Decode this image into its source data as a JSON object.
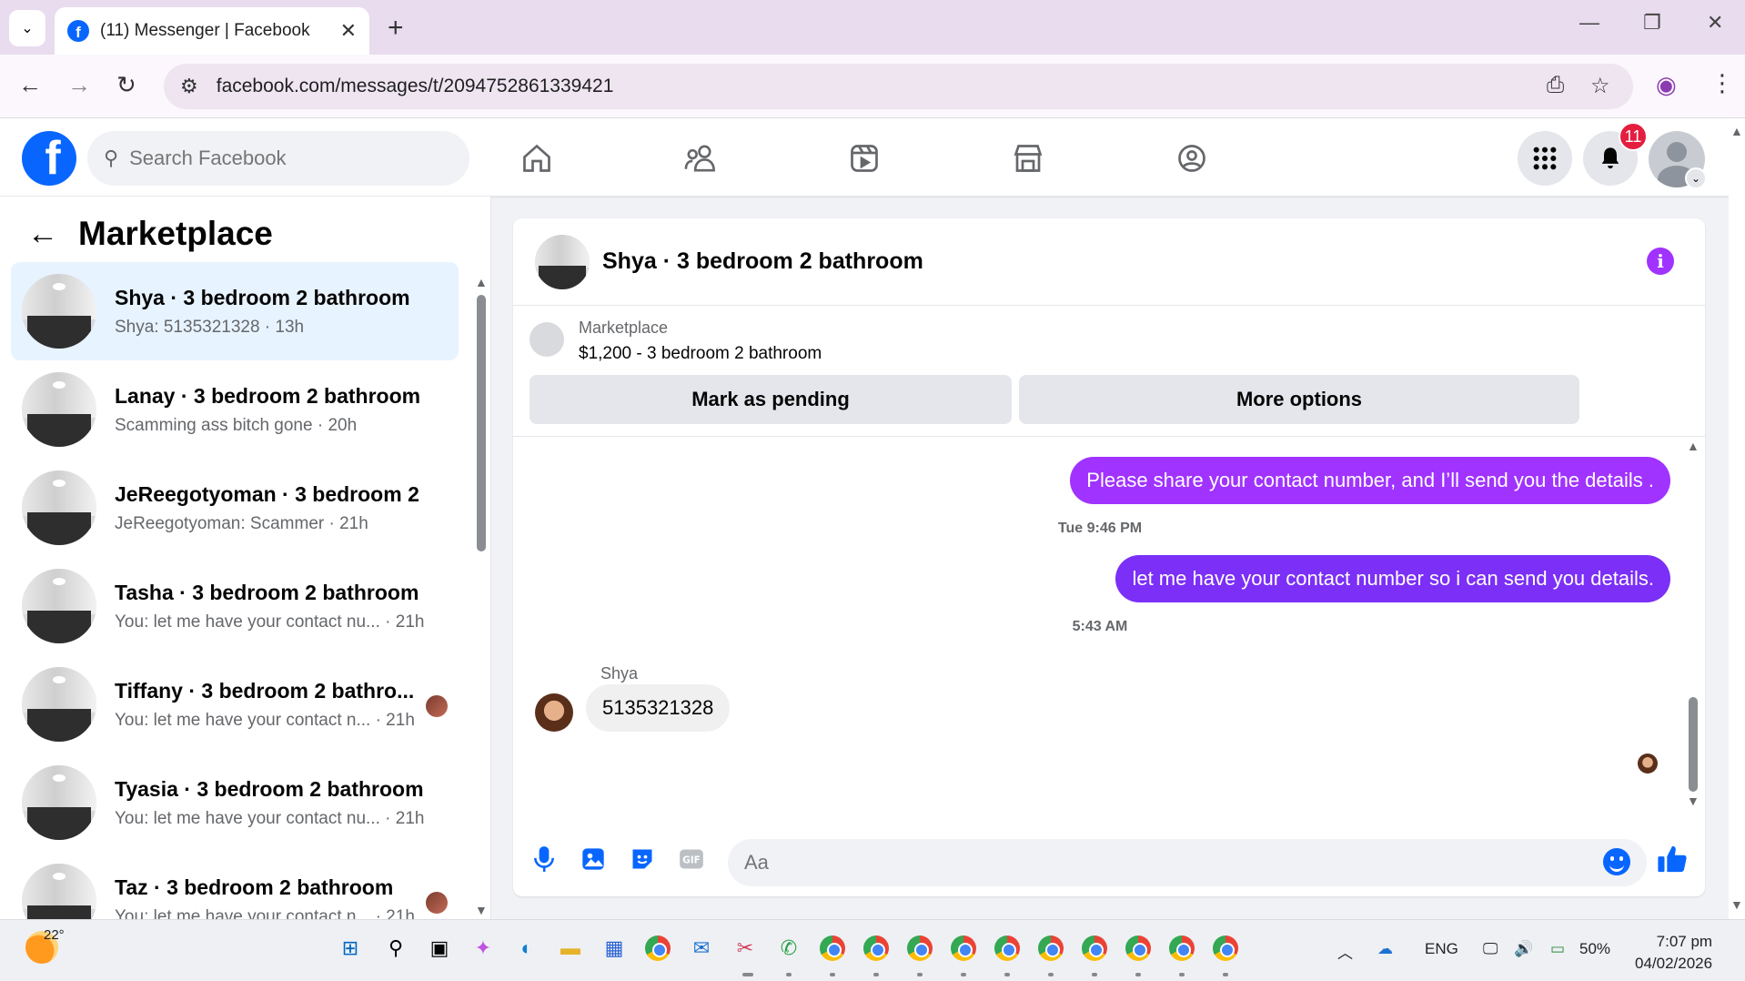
{
  "browser": {
    "tab_title": "(11) Messenger | Facebook",
    "url": "facebook.com/messages/t/2094752861339421"
  },
  "fb": {
    "search_placeholder": "Search Facebook",
    "notification_count": "11",
    "brand_color": "#0866ff"
  },
  "left": {
    "heading": "Marketplace",
    "conversations": [
      {
        "name": "Shya · 3 bedroom 2 bathroom",
        "preview": "Shya: 5135321328 · 13h",
        "active": true
      },
      {
        "name": "Lanay · 3 bedroom 2 bathroom",
        "preview": "Scamming ass bitch gone · 20h"
      },
      {
        "name": "JeReegotyoman · 3 bedroom 2 ...",
        "preview": "JeReegotyoman: Scammer · 21h"
      },
      {
        "name": "Tasha · 3 bedroom 2 bathroom",
        "preview": "You: let me have your contact nu... · 21h"
      },
      {
        "name": "Tiffany · 3 bedroom 2 bathro...",
        "preview": "You: let me have your contact n... · 21h"
      },
      {
        "name": "Tyasia · 3 bedroom 2 bathroom",
        "preview": "You: let me have your contact nu... · 21h"
      },
      {
        "name": "Taz · 3 bedroom 2 bathroom",
        "preview": "You: let me have your contact n... · 21h"
      }
    ]
  },
  "chat": {
    "title": "Shya · 3 bedroom 2 bathroom",
    "listing_source": "Marketplace",
    "listing_title": "$1,200 - 3 bedroom 2 bathroom",
    "mark_pending_label": "Mark as pending",
    "more_options_label": "More options",
    "messages": [
      {
        "text": "Please share your contact number, and I’ll send you the details .",
        "color": "#a033ff"
      },
      {
        "stamp": "Tue 9:46 PM"
      },
      {
        "text": "let me have your contact number so i can send you details.",
        "color": "#7b2ff7"
      },
      {
        "stamp": "5:43 AM"
      }
    ],
    "incoming_sender": "Shya",
    "incoming_text": "5135321328",
    "composer_placeholder": "Aa",
    "accent": "#0866ff"
  },
  "taskbar": {
    "temperature": "22°",
    "language": "ENG",
    "battery": "50%",
    "time": "7:07 pm",
    "date": "04/02/2026"
  }
}
